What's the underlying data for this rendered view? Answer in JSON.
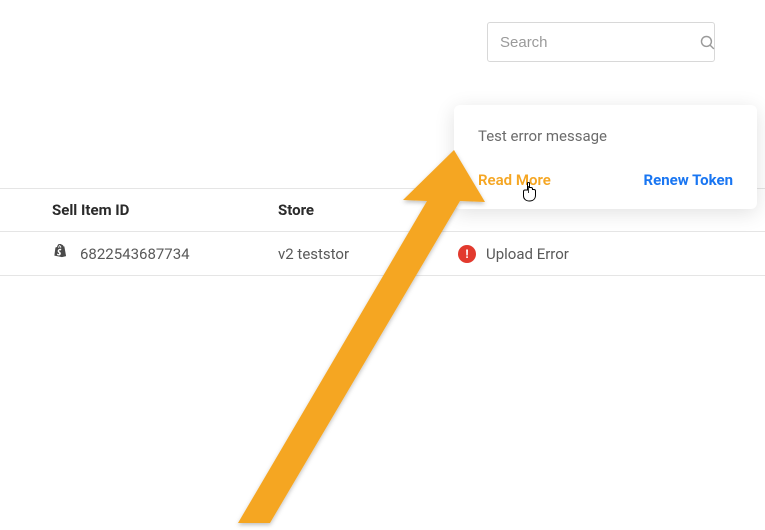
{
  "search": {
    "placeholder": "Search"
  },
  "popup": {
    "message": "Test error message",
    "read_more": "Read More",
    "renew_token": "Renew Token"
  },
  "table": {
    "headers": {
      "sell_item_id": "Sell Item ID",
      "store": "Store"
    },
    "row": {
      "sell_item_id": "6822543687734",
      "store": "v2 teststor",
      "status": "Upload Error"
    }
  }
}
